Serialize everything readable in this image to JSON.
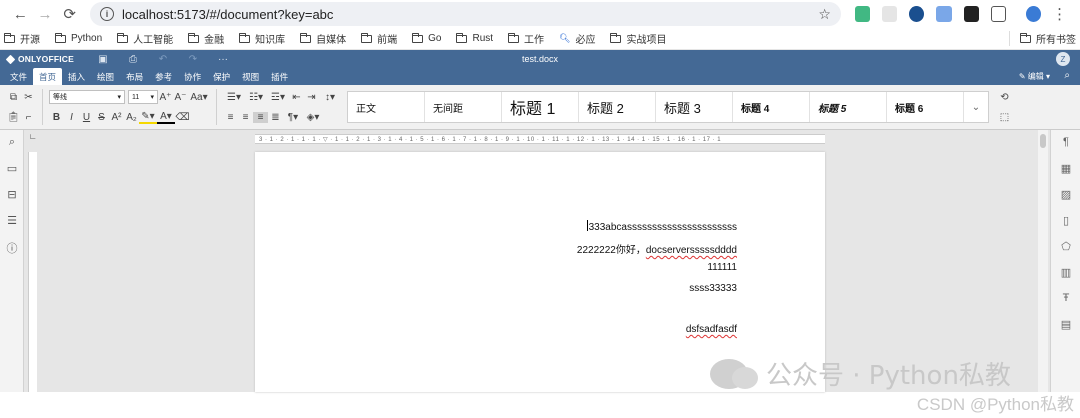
{
  "browser": {
    "url": "localhost:5173/#/document?key=abc",
    "bookmarks": [
      "开源",
      "Python",
      "人工智能",
      "金融",
      "知识库",
      "自媒体",
      "前端",
      "Go",
      "Rust",
      "工作",
      "必应",
      "实战项目"
    ],
    "bookmarks_right": "所有书签"
  },
  "app": {
    "logo": "ONLYOFFICE",
    "doc_title": "test.docx",
    "avatar": "Z",
    "edit_mode": "编辑",
    "tabs": [
      "文件",
      "首页",
      "插入",
      "绘图",
      "布局",
      "参考",
      "协作",
      "保护",
      "视图",
      "插件"
    ],
    "active_tab": "首页"
  },
  "toolbar": {
    "font_name": "等线",
    "font_size": "11",
    "styles": [
      "正文",
      "无间距",
      "标题 1",
      "标题 2",
      "标题 3",
      "标题 4",
      "标题 5",
      "标题 6"
    ]
  },
  "ruler": {
    "h_ticks": "3 · 1 · 2 · 1 · 1 · 1 · ▽ · 1 · 1 · 2 · 1 · 3 · 1 · 4 · 1 · 5 · 1 · 6 · 1 · 7 · 1 · 8 · 1 · 9 · 1 · 10 · 1 · 11 · 1 · 12 · 1 · 13 · 1 · 14 · 1 · 15 · 1 · 16 · 1 · 17 · 1"
  },
  "document": {
    "lines": [
      "333abcassssssssssssssssssssss",
      "2222222你好，",
      "docserversssssdddd",
      "111111",
      "ssss33333",
      "dsfsadfasdf"
    ]
  },
  "watermark": {
    "line1": "公众号 · Python私教",
    "line2": "CSDN @Python私教"
  }
}
